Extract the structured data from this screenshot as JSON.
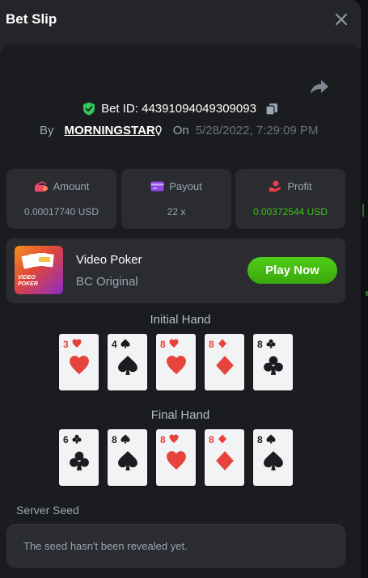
{
  "header": {
    "title": "Bet Slip"
  },
  "bet": {
    "id_label": "Bet ID: 44391094049309093",
    "by_label": "By",
    "username": "MORNINGSTAR",
    "on_label": "On",
    "date": "5/28/2022, 7:29:09 PM"
  },
  "stats": [
    {
      "label": "Amount",
      "value": "0.00017740 USD",
      "icon": "amount-icon"
    },
    {
      "label": "Payout",
      "value": "22 x",
      "icon": "payout-card-icon"
    },
    {
      "label": "Profit",
      "value": "0.00372544 USD",
      "icon": "profit-icon",
      "value_color": "#3bc117"
    }
  ],
  "game": {
    "name": "Video Poker",
    "subtitle": "BC Original",
    "thumb_label_1": "VIDEO",
    "thumb_label_2": "POKER",
    "play_label": "Play Now"
  },
  "initial_hand": {
    "title": "Initial Hand",
    "cards": [
      {
        "rank": "3",
        "suit": "hearts"
      },
      {
        "rank": "4",
        "suit": "spades"
      },
      {
        "rank": "8",
        "suit": "hearts"
      },
      {
        "rank": "8",
        "suit": "diamonds"
      },
      {
        "rank": "8",
        "suit": "clubs"
      }
    ]
  },
  "final_hand": {
    "title": "Final Hand",
    "cards": [
      {
        "rank": "6",
        "suit": "clubs"
      },
      {
        "rank": "8",
        "suit": "spades"
      },
      {
        "rank": "8",
        "suit": "hearts"
      },
      {
        "rank": "8",
        "suit": "diamonds"
      },
      {
        "rank": "8",
        "suit": "spades"
      }
    ]
  },
  "seed": {
    "label": "Server Seed",
    "text": "The seed hasn't been revealed yet."
  },
  "colors": {
    "accent_green": "#3bc117",
    "suit_red": "#e5433c",
    "verified_green": "#34c759"
  }
}
